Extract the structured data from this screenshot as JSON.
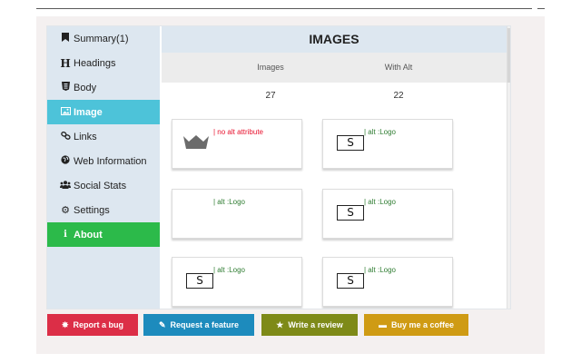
{
  "sidebar": {
    "items": [
      {
        "label": "Summary(1)",
        "icon": "bookmark-icon"
      },
      {
        "label": "Headings",
        "icon": "heading-icon"
      },
      {
        "label": "Body",
        "icon": "html5-icon"
      },
      {
        "label": "Image",
        "icon": "image-icon"
      },
      {
        "label": "Links",
        "icon": "link-icon"
      },
      {
        "label": "Web Information",
        "icon": "globe-icon"
      },
      {
        "label": "Social Stats",
        "icon": "users-icon"
      },
      {
        "label": "Settings",
        "icon": "gear-icon"
      },
      {
        "label": "About",
        "icon": "info-icon"
      }
    ],
    "active": "Image"
  },
  "main": {
    "title": "IMAGES",
    "stats": {
      "headers": [
        "Images",
        "With Alt"
      ],
      "values": [
        "27",
        "22"
      ]
    },
    "cards": [
      {
        "label": "| no alt attribute",
        "image": "crown-icon",
        "status": "missing"
      },
      {
        "label": "| alt :Logo",
        "image": "s-logo",
        "status": "ok"
      },
      {
        "label": "| alt :Logo",
        "image": "none",
        "status": "ok"
      },
      {
        "label": "| alt :Logo",
        "image": "s-logo",
        "status": "ok"
      },
      {
        "label": "| alt :Logo",
        "image": "s-logo",
        "status": "ok"
      },
      {
        "label": "| alt :Logo",
        "image": "s-logo",
        "status": "ok"
      }
    ],
    "logo_letter": "S"
  },
  "footer": {
    "buttons": [
      {
        "label": "Report a bug",
        "icon": "bug-icon",
        "color": "#dc2e47"
      },
      {
        "label": "Request a feature",
        "icon": "pencil-icon",
        "color": "#1d8bbd"
      },
      {
        "label": "Write a review",
        "icon": "star-icon",
        "color": "#7e8a18"
      },
      {
        "label": "Buy me a coffee",
        "icon": "coffee-icon",
        "color": "#cf9b14"
      }
    ]
  },
  "colors": {
    "active_nav": "#4dc3d9",
    "about_nav": "#2cba4a",
    "sidebar_bg": "#dde7f0",
    "missing_alt": "#e8112d",
    "alt_ok": "#2f7d32"
  }
}
